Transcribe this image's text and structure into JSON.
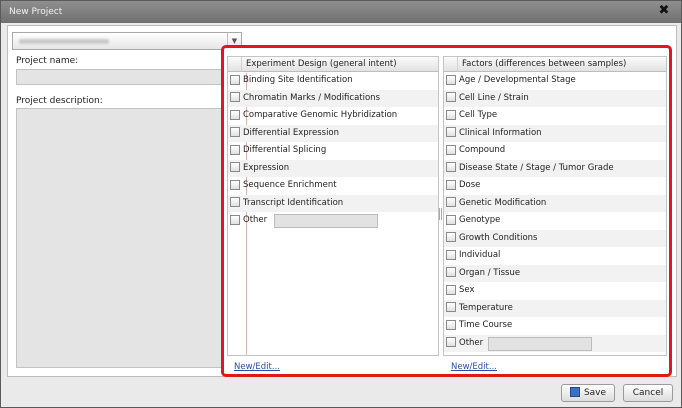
{
  "window": {
    "title": "New Project",
    "close_label": "✖"
  },
  "form": {
    "project_name_label": "Project name:",
    "project_description_label": "Project description:"
  },
  "experiment_design": {
    "header": "Experiment Design (general intent)",
    "items": [
      "Binding Site Identification",
      "Chromatin Marks / Modifications",
      "Comparative Genomic Hybridization",
      "Differential Expression",
      "Differential Splicing",
      "Expression",
      "Sequence Enrichment",
      "Transcript Identification"
    ],
    "other_label": "Other",
    "link": "New/Edit..."
  },
  "factors": {
    "header": "Factors (differences between samples)",
    "items": [
      "Age / Developmental Stage",
      "Cell Line / Strain",
      "Cell Type",
      "Clinical Information",
      "Compound",
      "Disease State / Stage / Tumor Grade",
      "Dose",
      "Genetic Modification",
      "Genotype",
      "Growth Conditions",
      "Individual",
      "Organ / Tissue",
      "Sex",
      "Temperature",
      "Time Course"
    ],
    "other_label": "Other",
    "link": "New/Edit..."
  },
  "buttons": {
    "save": "Save",
    "cancel": "Cancel"
  },
  "colors": {
    "highlight_border": "#e01818",
    "link": "#2a4da8"
  }
}
